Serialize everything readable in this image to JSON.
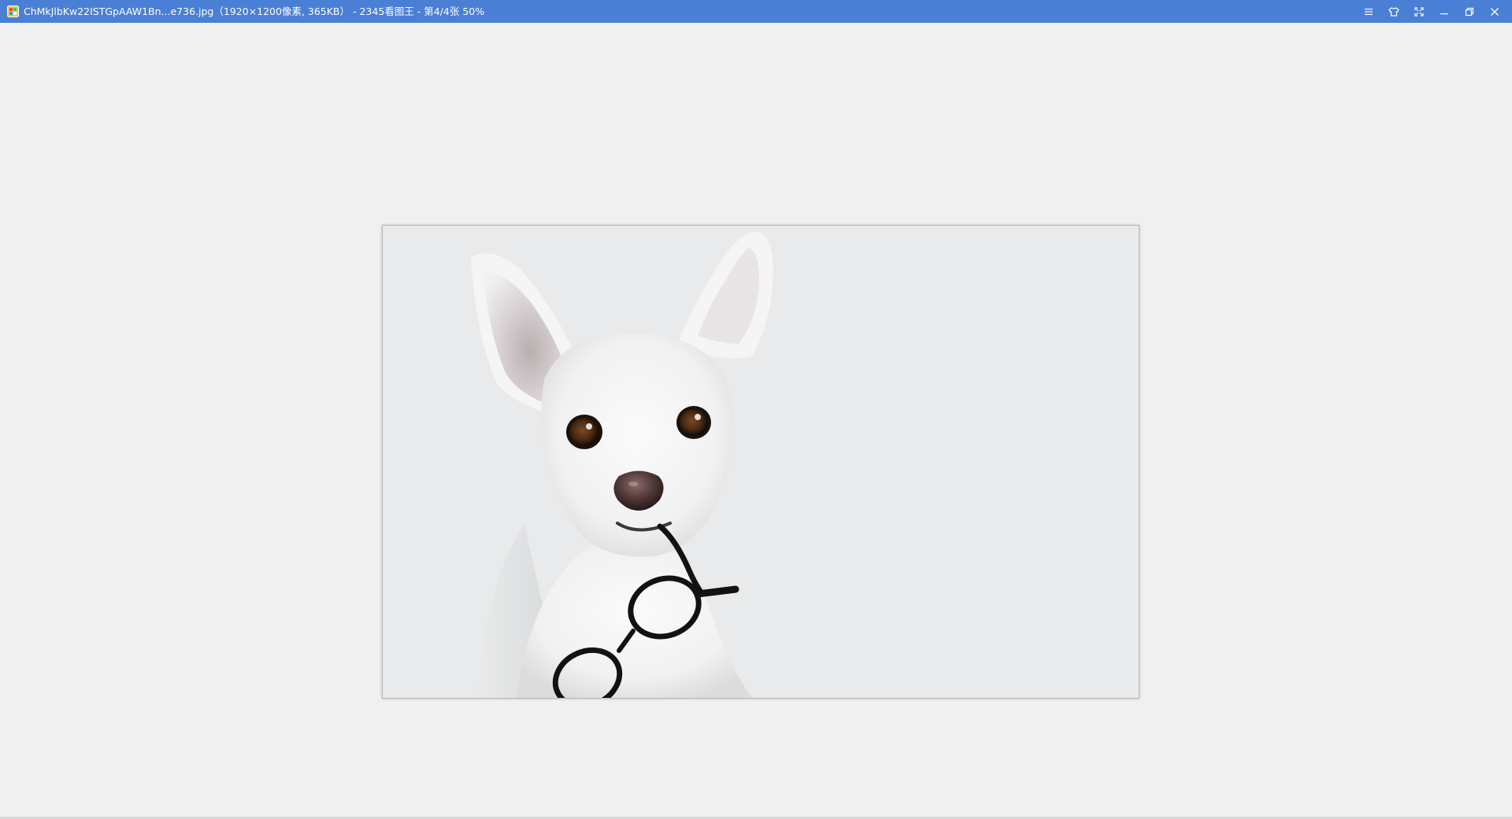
{
  "window": {
    "title": "ChMkJlbKw22ISTGpAAW1Bn...e736.jpg（1920×1200像素, 365KB） - 2345看图王 - 第4/4张 50%",
    "titlebar_color": "#4a7fd6",
    "app_icon": "2345-viewer-app-icon"
  },
  "controls": [
    {
      "name": "menu-icon"
    },
    {
      "name": "skin-icon"
    },
    {
      "name": "fullscreen-icon"
    },
    {
      "name": "minimize-icon"
    },
    {
      "name": "restore-icon"
    },
    {
      "name": "close-icon"
    }
  ],
  "viewer": {
    "background": "#f0f0f0",
    "image_subject": "dog-with-glasses-photo"
  }
}
